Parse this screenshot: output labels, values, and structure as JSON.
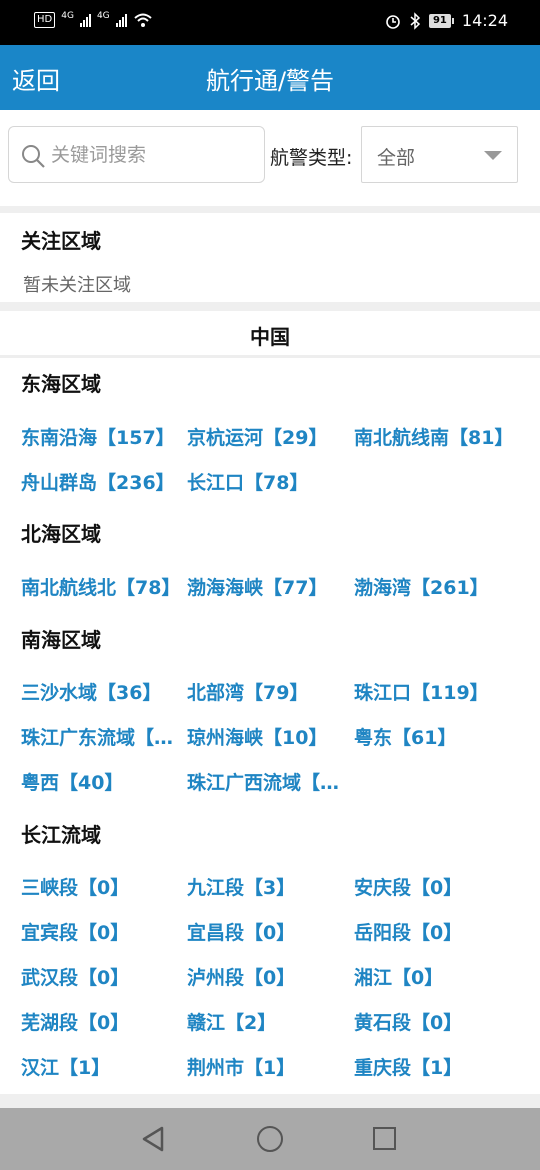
{
  "status_bar": {
    "hd_label": "HD",
    "sim1_label": "4G",
    "sim2_label": "4G",
    "wifi_icon": "wifi-icon",
    "alarm_icon": "alarm-icon",
    "bluetooth_icon": "bluetooth-icon",
    "battery": "91",
    "time": "14:24"
  },
  "header": {
    "back_label": "返回",
    "title": "航行通/警告",
    "background": "#1a86c8"
  },
  "search": {
    "placeholder": "关键词搜索",
    "value": "",
    "type_label": "航警类型:",
    "type_value": "全部"
  },
  "follow": {
    "title": "关注区域",
    "empty_text": "暂未关注区域"
  },
  "country": "中国",
  "link_color": "#1f85c3",
  "regions": [
    {
      "title": "东海区域",
      "areas": [
        "东南沿海【157】",
        "京杭运河【29】",
        "南北航线南【81】",
        "舟山群岛【236】",
        "长江口【78】"
      ]
    },
    {
      "title": "北海区域",
      "areas": [
        "南北航线北【78】",
        "渤海海峡【77】",
        "渤海湾【261】"
      ]
    },
    {
      "title": "南海区域",
      "areas": [
        "三沙水域【36】",
        "北部湾【79】",
        "珠江口【119】",
        "珠江广东流域【…",
        "琼州海峡【10】",
        "粤东【61】",
        "粤西【40】",
        "珠江广西流域【…"
      ]
    },
    {
      "title": "长江流域",
      "areas": [
        "三峡段【0】",
        "九江段【3】",
        "安庆段【0】",
        "宜宾段【0】",
        "宜昌段【0】",
        "岳阳段【0】",
        "武汉段【0】",
        "泸州段【0】",
        "湘江【0】",
        "芜湖段【0】",
        "赣江【2】",
        "黄石段【0】",
        "汉江【1】",
        "荆州市【1】",
        "重庆段【1】"
      ]
    }
  ],
  "nav_bar": {
    "back_icon": "triangle-back-icon",
    "home_icon": "circle-home-icon",
    "recent_icon": "square-recent-icon"
  }
}
